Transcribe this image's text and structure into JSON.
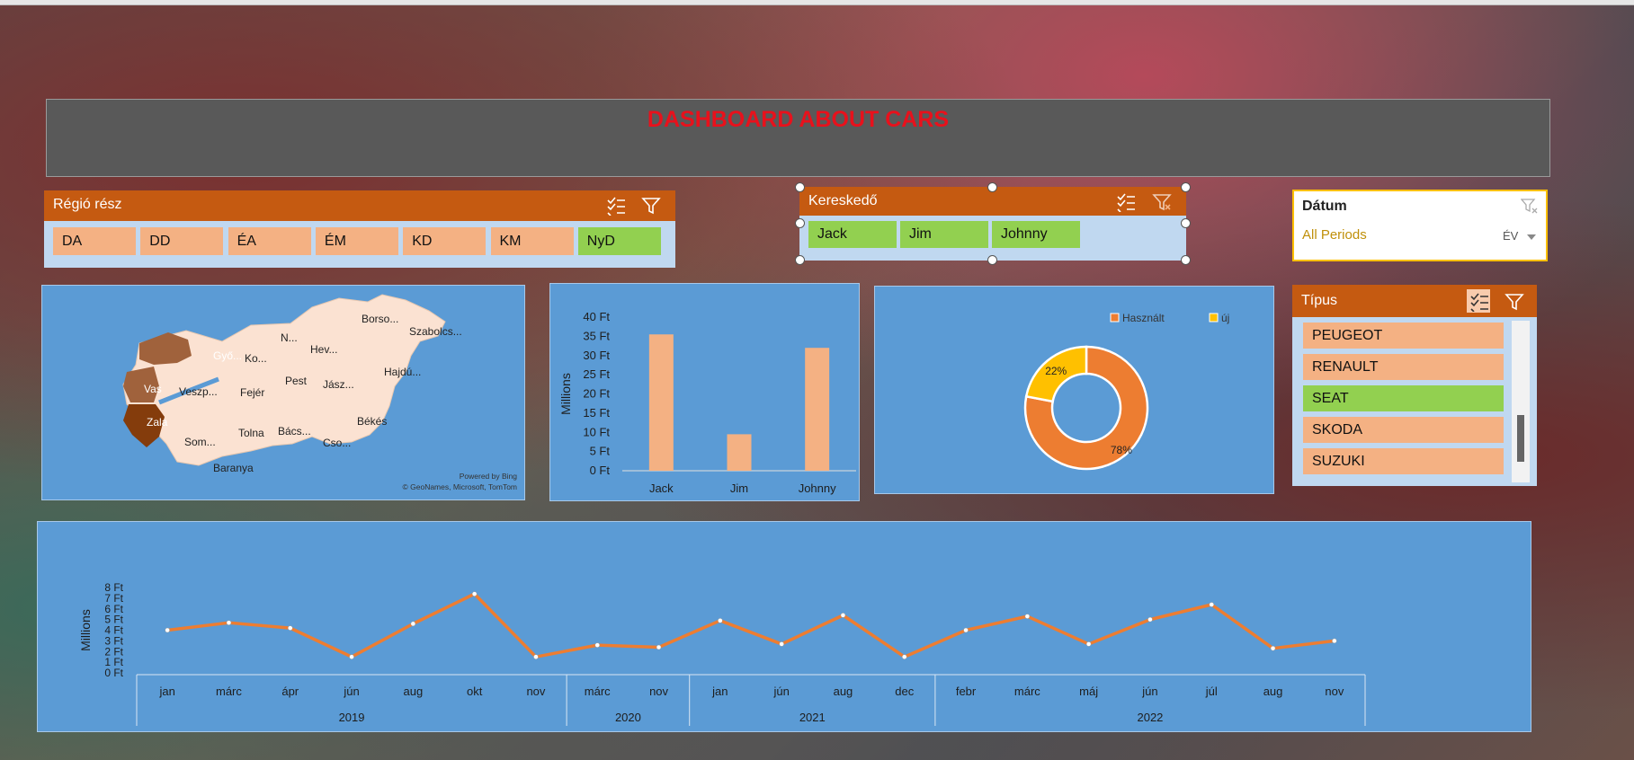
{
  "header": {
    "title": "DASHBOARD ABOUT CARS"
  },
  "region_slicer": {
    "title": "Régió rész",
    "items": [
      {
        "label": "DA",
        "selected": false
      },
      {
        "label": "DD",
        "selected": false
      },
      {
        "label": "ÉA",
        "selected": false
      },
      {
        "label": "ÉM",
        "selected": false
      },
      {
        "label": "KD",
        "selected": false
      },
      {
        "label": "KM",
        "selected": false
      },
      {
        "label": "NyD",
        "selected": true
      }
    ]
  },
  "dealer_slicer": {
    "title": "Kereskedő",
    "items": [
      {
        "label": "Jack",
        "selected": true
      },
      {
        "label": "Jim",
        "selected": true
      },
      {
        "label": "Johnny",
        "selected": true
      }
    ]
  },
  "date_slicer": {
    "title": "Dátum",
    "value": "All Periods",
    "level": "ÉV"
  },
  "type_slicer": {
    "title": "Típus",
    "items": [
      {
        "label": "PEUGEOT",
        "selected": false
      },
      {
        "label": "RENAULT",
        "selected": false
      },
      {
        "label": "SEAT",
        "selected": true
      },
      {
        "label": "SKODA",
        "selected": false
      },
      {
        "label": "SUZUKI",
        "selected": false
      }
    ]
  },
  "map": {
    "labels": [
      "Borso...",
      "Szabolcs...",
      "N...",
      "Hev...",
      "Győ...",
      "Ko...",
      "Hajdú...",
      "Pest",
      "Jász...",
      "Vas",
      "Veszp...",
      "Fejér",
      "Zala",
      "Bács...",
      "Békés",
      "Som...",
      "Tolna",
      "Cso...",
      "Baranya"
    ],
    "highlighted": [
      "Győ...",
      "Vas",
      "Zala"
    ],
    "credit_1": "Powered by Bing",
    "credit_2": "© GeoNames, Microsoft, TomTom"
  },
  "colors": {
    "orange": "#ed7d31",
    "bar": "#f4b183",
    "yellow": "#ffc000",
    "panel": "#5b9bd5",
    "slicer_head": "#c55a11",
    "selected": "#92d050",
    "title": "#e8111c"
  },
  "chart_data": [
    {
      "type": "bar",
      "categories": [
        "Jack",
        "Jim",
        "Johnny"
      ],
      "values": [
        35.5,
        9.5,
        32
      ],
      "ylabel": "Millions",
      "ylim": [
        0,
        40
      ],
      "yticks": [
        "0 Ft",
        "5 Ft",
        "10 Ft",
        "15 Ft",
        "20 Ft",
        "25 Ft",
        "30 Ft",
        "35 Ft",
        "40 Ft"
      ]
    },
    {
      "type": "pie",
      "donut": true,
      "series": [
        {
          "name": "Használt",
          "value": 78,
          "label": "78%"
        },
        {
          "name": "új",
          "value": 22,
          "label": "22%"
        }
      ],
      "legend": "top"
    },
    {
      "type": "line",
      "ylabel": "Millions",
      "ylim": [
        0,
        8
      ],
      "yticks": [
        "0 Ft",
        "1 Ft",
        "2 Ft",
        "3 Ft",
        "4 Ft",
        "5 Ft",
        "6 Ft",
        "7 Ft",
        "8 Ft"
      ],
      "groups": [
        {
          "year": "2019",
          "months": [
            "jan",
            "márc",
            "ápr",
            "jún",
            "aug",
            "okt",
            "nov"
          ]
        },
        {
          "year": "2020",
          "months": [
            "márc",
            "nov"
          ]
        },
        {
          "year": "2021",
          "months": [
            "jan",
            "jún",
            "aug",
            "dec"
          ]
        },
        {
          "year": "2022",
          "months": [
            "febr",
            "márc",
            "máj",
            "jún",
            "júl",
            "aug",
            "nov"
          ]
        }
      ],
      "values": [
        4,
        4.7,
        4.2,
        1.5,
        4.6,
        7.4,
        1.5,
        2.6,
        2.4,
        4.9,
        2.7,
        5.4,
        1.5,
        4,
        5.3,
        2.7,
        5,
        6.4,
        2.3,
        3
      ]
    }
  ]
}
